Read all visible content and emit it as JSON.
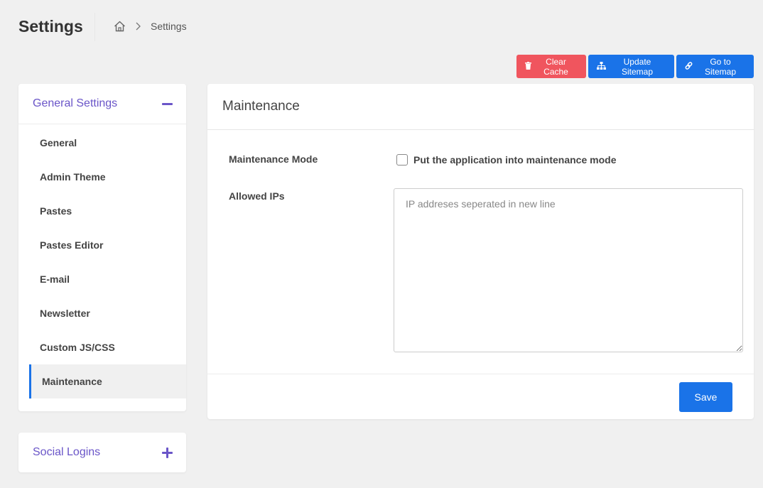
{
  "header": {
    "title": "Settings",
    "breadcrumb": {
      "home_icon": "home-icon",
      "separator_icon": "chevron-right-icon",
      "current": "Settings"
    }
  },
  "toolbar": {
    "clear_cache": {
      "label": "Clear Cache",
      "icon": "trash-icon",
      "color": "#f0555e"
    },
    "update_sitemap": {
      "label": "Update Sitemap",
      "icon": "sitemap-icon",
      "color": "#1a73e8"
    },
    "go_to_sitemap": {
      "label": "Go to Sitemap",
      "icon": "link-icon",
      "color": "#1a73e8"
    }
  },
  "sidebar": {
    "general": {
      "title": "General Settings",
      "toggle_icon": "minus-icon",
      "items": [
        {
          "label": "General"
        },
        {
          "label": "Admin Theme"
        },
        {
          "label": "Pastes"
        },
        {
          "label": "Pastes Editor"
        },
        {
          "label": "E-mail"
        },
        {
          "label": "Newsletter"
        },
        {
          "label": "Custom JS/CSS"
        },
        {
          "label": "Maintenance",
          "active": true
        }
      ]
    },
    "social": {
      "title": "Social Logins",
      "toggle_icon": "plus-icon"
    }
  },
  "main": {
    "title": "Maintenance",
    "maintenance_mode": {
      "label": "Maintenance Mode",
      "checkbox_label": "Put the application into maintenance mode",
      "checked": false
    },
    "allowed_ips": {
      "label": "Allowed IPs",
      "placeholder": "IP addreses seperated in new line",
      "value": ""
    },
    "save_label": "Save"
  },
  "colors": {
    "accent": "#6a55c8",
    "primary": "#1a73e8",
    "danger": "#f0555e",
    "background": "#f0f0f0"
  }
}
